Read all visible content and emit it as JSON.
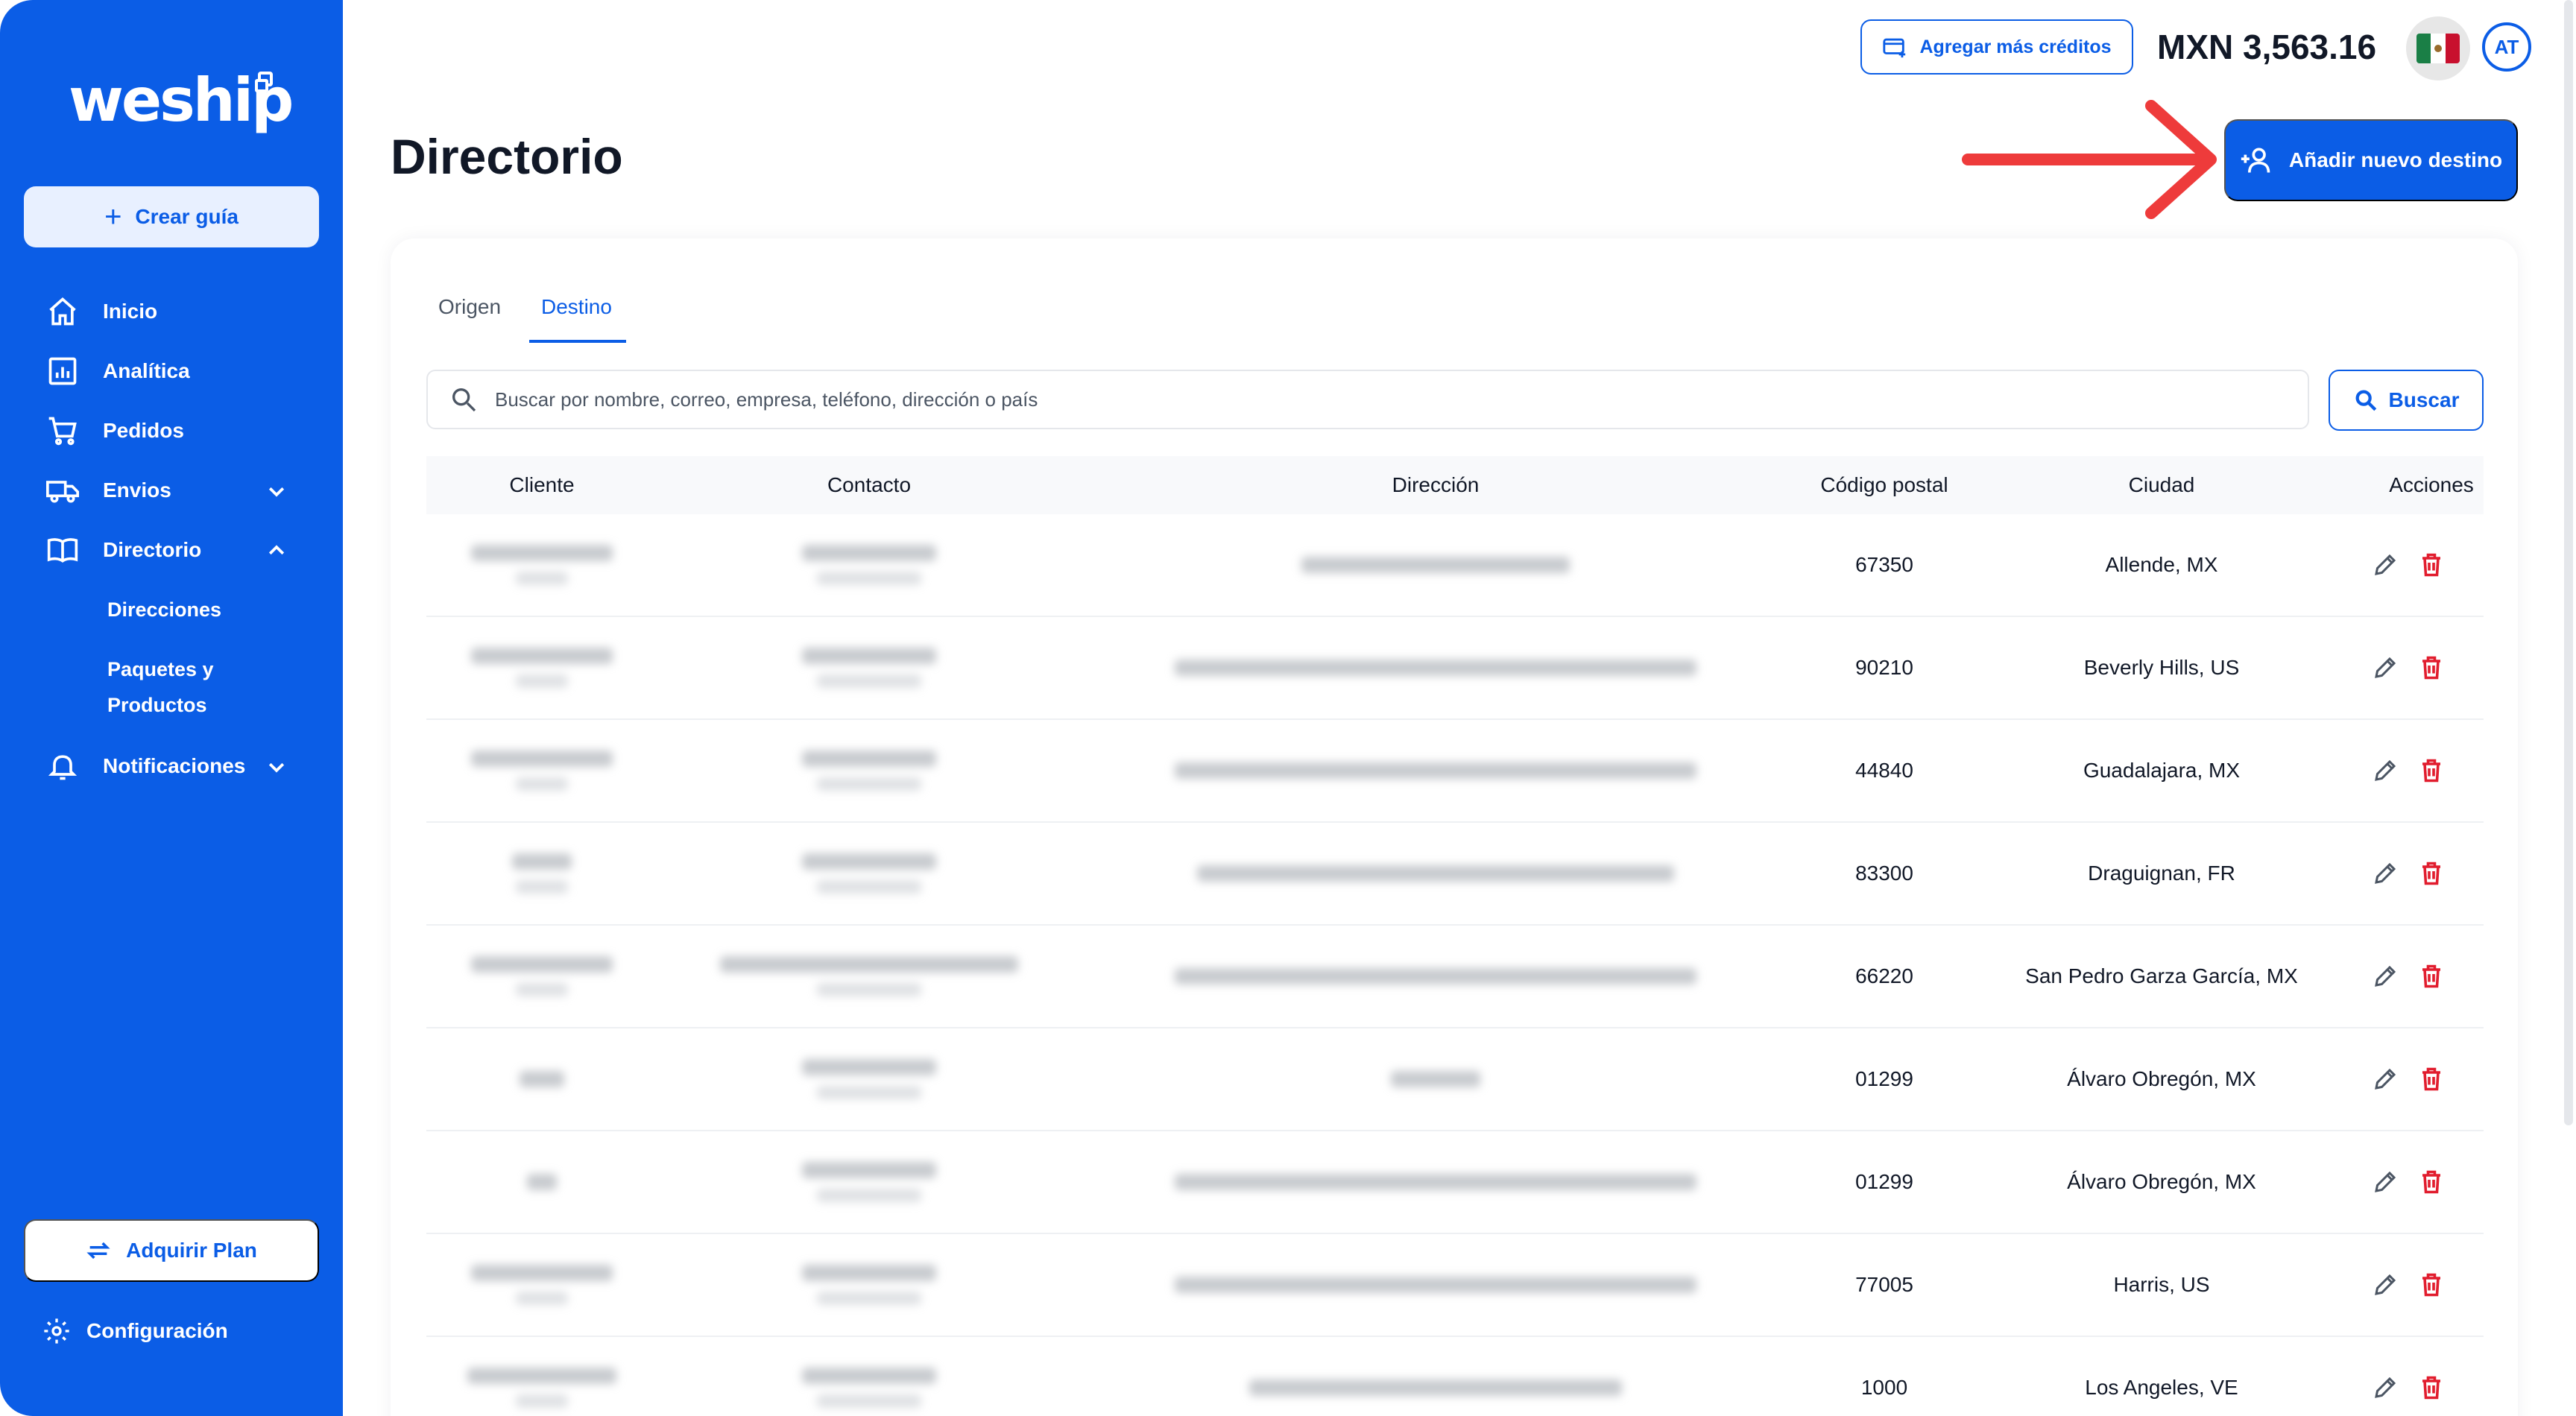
{
  "sidebar": {
    "logo": "weship",
    "create_label": "Crear guía",
    "items": [
      {
        "label": "Inicio"
      },
      {
        "label": "Analítica"
      },
      {
        "label": "Pedidos"
      },
      {
        "label": "Envios"
      },
      {
        "label": "Directorio"
      },
      {
        "label": "Notificaciones"
      }
    ],
    "sub_items": [
      {
        "label": "Direcciones"
      },
      {
        "label": "Paquetes y"
      },
      {
        "label": "Productos"
      }
    ],
    "plan_label": "Adquirir Plan",
    "config_label": "Configuración"
  },
  "header": {
    "credits_label": "Agregar más créditos",
    "balance": "MXN 3,563.16",
    "avatar_initials": "AT"
  },
  "page": {
    "title": "Directorio",
    "add_button_label": "Añadir nuevo destino"
  },
  "tabs": [
    {
      "label": "Origen",
      "active": false
    },
    {
      "label": "Destino",
      "active": true
    }
  ],
  "search": {
    "placeholder": "Buscar por nombre, correo, empresa, teléfono, dirección o país",
    "button_label": "Buscar"
  },
  "table": {
    "columns": [
      "Cliente",
      "Contacto",
      "Dirección",
      "Código postal",
      "Ciudad",
      "Acciones"
    ],
    "rows": [
      {
        "postal": "67350",
        "city": "Allende, MX"
      },
      {
        "postal": "90210",
        "city": "Beverly Hills, US"
      },
      {
        "postal": "44840",
        "city": "Guadalajara, MX"
      },
      {
        "postal": "83300",
        "city": "Draguignan, FR"
      },
      {
        "postal": "66220",
        "city": "San Pedro Garza García, MX"
      },
      {
        "postal": "01299",
        "city": "Álvaro Obregón, MX"
      },
      {
        "postal": "01299",
        "city": "Álvaro Obregón, MX"
      },
      {
        "postal": "77005",
        "city": "Harris, US"
      },
      {
        "postal": "1000",
        "city": "Los Angeles, VE"
      }
    ]
  },
  "colors": {
    "brand": "#0b5de6",
    "danger": "#e11d2e",
    "annotation_arrow": "#ee3b3b"
  }
}
